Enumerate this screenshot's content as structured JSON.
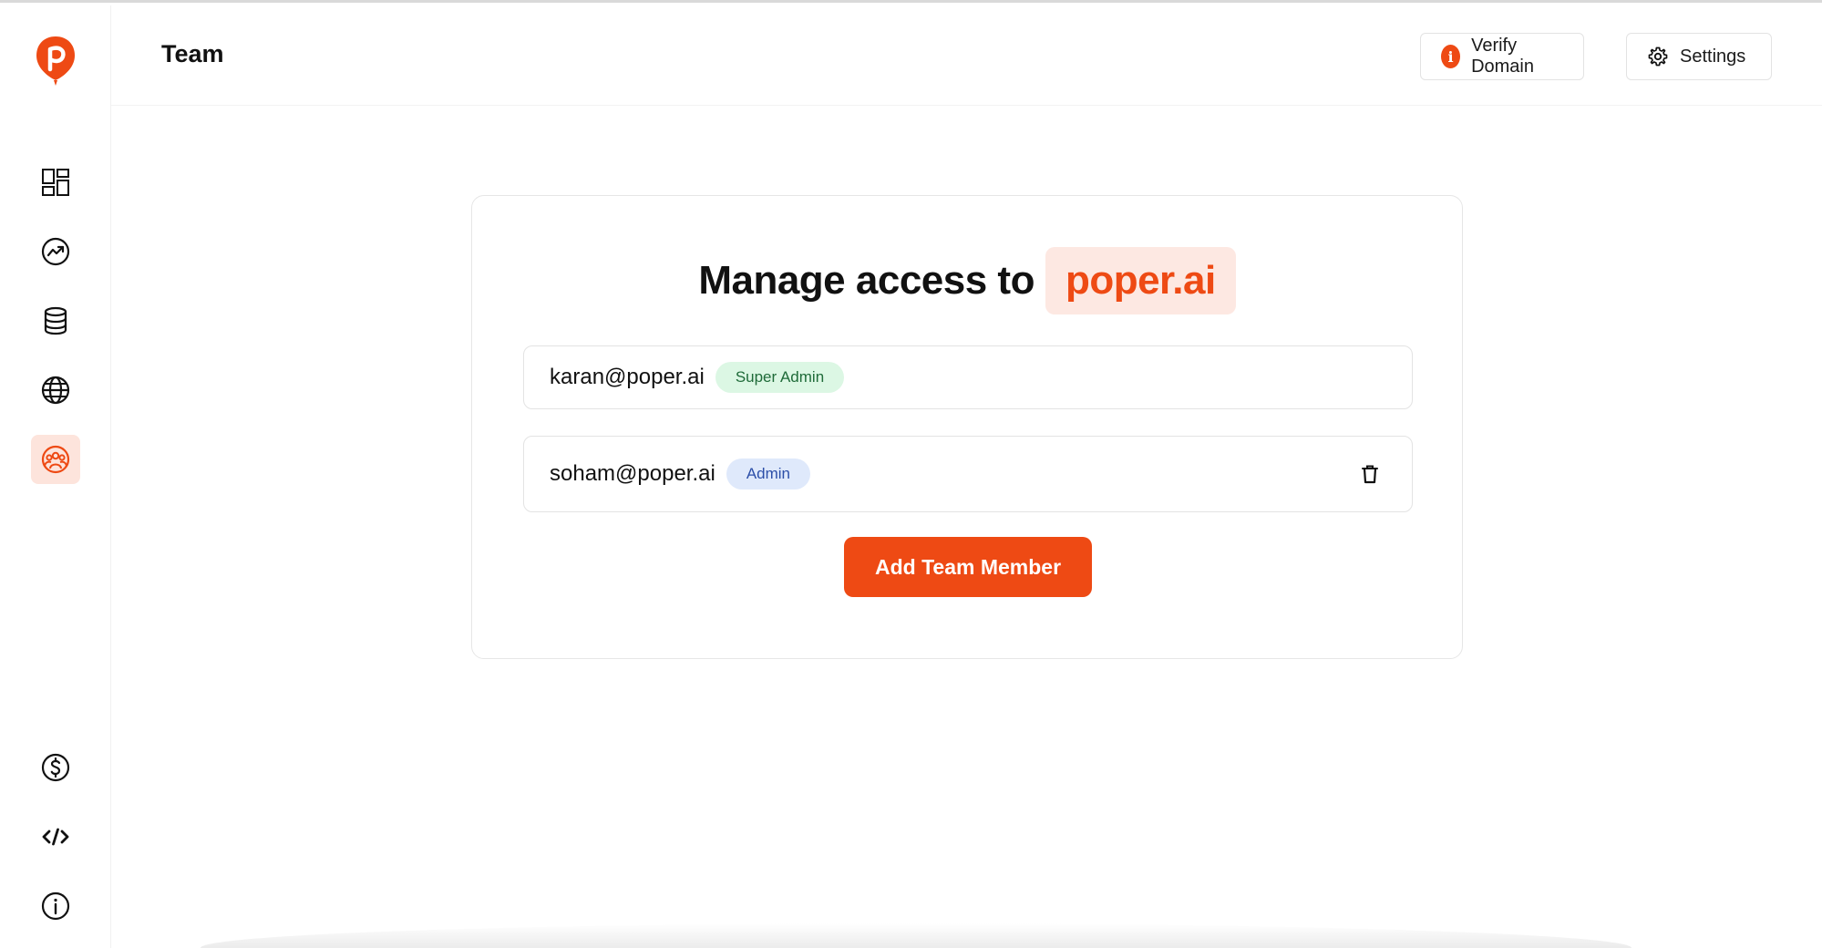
{
  "header": {
    "title": "Team",
    "verify_label": "Verify Domain",
    "settings_label": "Settings"
  },
  "sidebar": {
    "items": [
      {
        "name": "dashboard",
        "icon": "grid-icon"
      },
      {
        "name": "analytics",
        "icon": "trend-icon"
      },
      {
        "name": "data",
        "icon": "database-icon"
      },
      {
        "name": "web",
        "icon": "globe-icon"
      },
      {
        "name": "team",
        "icon": "team-icon",
        "active": true
      },
      {
        "name": "billing",
        "icon": "dollar-icon"
      },
      {
        "name": "developer",
        "icon": "code-icon"
      },
      {
        "name": "info",
        "icon": "info-icon"
      }
    ]
  },
  "card": {
    "heading": "Manage access to",
    "domain": "poper.ai",
    "members": [
      {
        "email": "karan@poper.ai",
        "role": "Super Admin",
        "deletable": false
      },
      {
        "email": "soham@poper.ai",
        "role": "Admin",
        "deletable": true
      }
    ],
    "add_button": "Add Team Member"
  },
  "colors": {
    "accent": "#ee4a14",
    "accent_soft": "#fde8e2",
    "super_admin_bg": "#dcf7e4",
    "admin_bg": "#dfe9fb"
  }
}
